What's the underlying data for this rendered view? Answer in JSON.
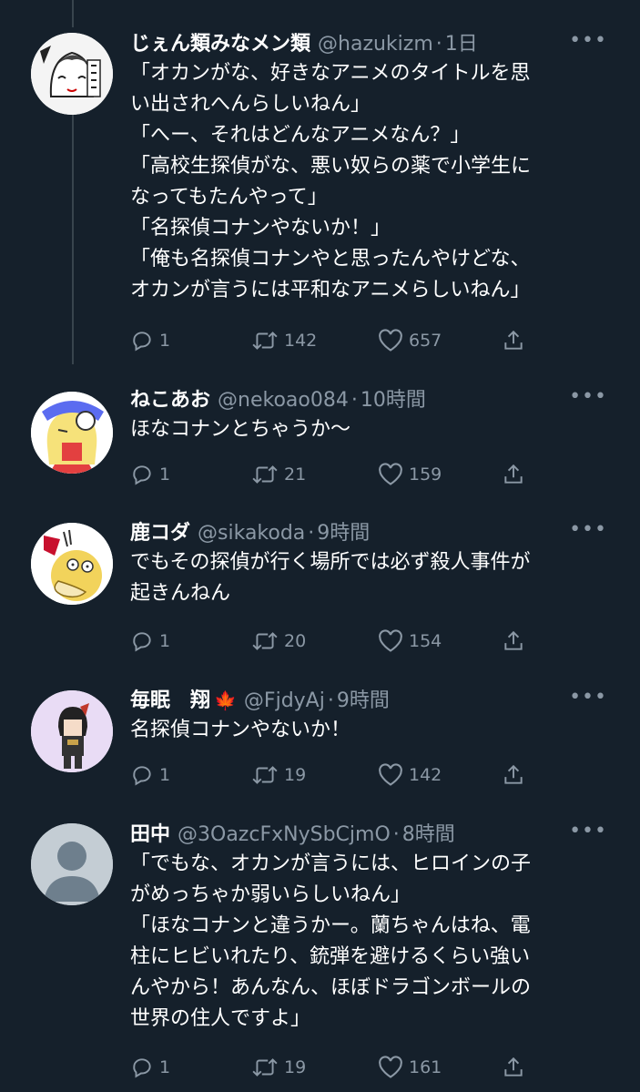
{
  "tweets": [
    {
      "name": "じぇん類みなメン類",
      "handle": "@hazukizm",
      "dot": "·",
      "time": "1日",
      "more": "•••",
      "lines": [
        "「オカンがな、好きなアニメのタイトルを思",
        "い出されへんらしいねん」",
        "「へー、それはどんなアニメなん？」",
        "「高校生探偵がな、悪い奴らの薬で小学生に",
        "なってもたんやって」",
        "「名探偵コナンやないか！」",
        "「俺も名探偵コナンやと思ったんやけどな、",
        "オカンが言うには平和なアニメらしいねん」"
      ],
      "replies": "1",
      "retweets": "142",
      "likes": "657",
      "avatar_icon": "manga-avatar"
    },
    {
      "name": "ねこあお",
      "handle": "@nekoao084",
      "dot": "·",
      "time": "10時間",
      "more": "•••",
      "lines": [
        "ほなコナンとちゃうか〜"
      ],
      "replies": "1",
      "retweets": "21",
      "likes": "159",
      "avatar_icon": "anime-avatar"
    },
    {
      "name": "鹿コダ",
      "handle": "@sikakoda",
      "dot": "·",
      "time": "9時間",
      "more": "•••",
      "lines": [
        "でもその探偵が行く場所では必ず殺人事件が",
        "起きんねん"
      ],
      "replies": "1",
      "retweets": "20",
      "likes": "154",
      "avatar_icon": "psyduck-avatar"
    },
    {
      "name": "毎眠　翔",
      "name_emoji": "🍁",
      "handle": "@FjdyAj",
      "dot": "·",
      "time": "9時間",
      "more": "•••",
      "lines": [
        "名探偵コナンやないか！"
      ],
      "replies": "1",
      "retweets": "19",
      "likes": "142",
      "avatar_icon": "character-avatar"
    },
    {
      "name": "田中",
      "handle": "@3OazcFxNySbCjmO",
      "dot": "·",
      "time": "8時間",
      "more": "•••",
      "lines": [
        "「でもな、オカンが言うには、ヒロインの子",
        "がめっちゃか弱いらしいねん」",
        "「ほなコナンと違うかー。蘭ちゃんはね、電",
        "柱にヒビいれたり、銃弾を避けるくらい強い",
        "んやから！あんなん、ほぼドラゴンボールの",
        "世界の住人ですよ」"
      ],
      "replies": "1",
      "retweets": "19",
      "likes": "161",
      "avatar_icon": "default-avatar"
    }
  ],
  "colors": {
    "background": "#15202b",
    "text": "#ffffff",
    "secondary": "#8b98a5",
    "divider": "#38444d"
  }
}
